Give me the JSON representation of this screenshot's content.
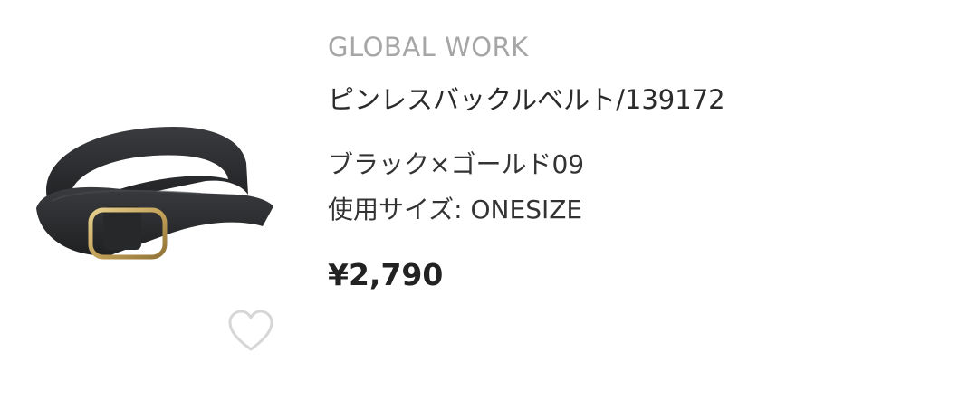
{
  "product": {
    "brand": "GLOBAL WORK",
    "name": "ピンレスバックルベルト/139172",
    "color": "ブラック×ゴールド09",
    "size_label": "使用サイズ:",
    "size_value": "ONESIZE",
    "price": "¥2,790",
    "image_icon": "belt-product-image",
    "favorite_icon": "heart-outline-icon"
  },
  "colors": {
    "brand_text": "#a6a6a6",
    "belt_leather": "#2e2f31",
    "buckle_gold": "#c9a85a",
    "heart_outline": "#d6d6d6"
  }
}
